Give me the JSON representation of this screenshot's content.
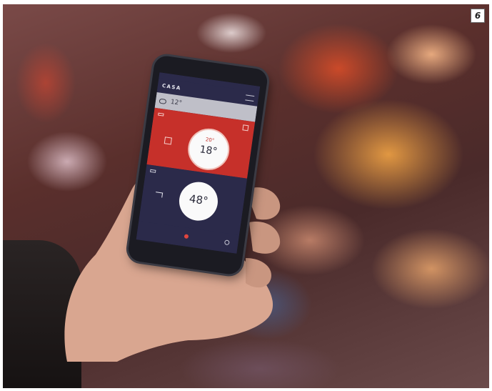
{
  "figure": {
    "page_number": "6"
  },
  "app": {
    "title": "CASA",
    "weather": {
      "temperature": "12°"
    },
    "heating": {
      "setpoint": "20°",
      "current_temperature": "18°"
    },
    "water": {
      "temperature": "48°"
    }
  },
  "colors": {
    "heating_panel": "#c6302a",
    "app_background": "#2b2a4a",
    "weather_bar": "#bfbfc8"
  },
  "icons": [
    "menu-icon",
    "cloud-icon",
    "flame-icon",
    "radiator-icon",
    "tap-icon",
    "home-icon",
    "settings-icon"
  ]
}
